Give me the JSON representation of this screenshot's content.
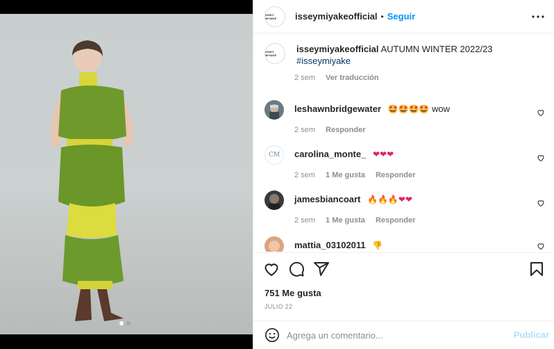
{
  "header": {
    "brand_logo_text": "ISSEY MIYAKE",
    "username": "isseymiyakeofficial",
    "separator": "•",
    "follow_label": "Seguir",
    "more_label": "•••"
  },
  "caption": {
    "username": "isseymiyakeofficial",
    "text": "AUTUMN WINTER 2022/23",
    "hashtag": "#isseymiyake",
    "time": "2 sem",
    "translate_label": "Ver traducción"
  },
  "comments": [
    {
      "user": "leshawnbridgewater",
      "emoji": "🤩🤩🤩🤩",
      "text": "wow",
      "time": "2 sem",
      "likes": "",
      "reply_label": "Responder"
    },
    {
      "user": "carolina_monte_",
      "emoji": "❤❤❤",
      "text": "",
      "time": "2 sem",
      "likes": "1 Me gusta",
      "reply_label": "Responder",
      "avatar_text": "CM"
    },
    {
      "user": "jamesbiancoart",
      "emoji": "🔥🔥🔥❤❤",
      "text": "",
      "time": "2 sem",
      "likes": "1 Me gusta",
      "reply_label": "Responder"
    },
    {
      "user": "mattia_03102011",
      "emoji": "👎",
      "text": "",
      "time": "",
      "likes": "",
      "reply_label": ""
    }
  ],
  "actions": {
    "likes_count": "751 Me gusta",
    "date": "JULIO 22",
    "icons": [
      "heart-icon",
      "comment-icon",
      "share-icon",
      "bookmark-icon"
    ]
  },
  "composer": {
    "emoji_icon": "smiley-icon",
    "placeholder": "Agrega un comentario...",
    "publish_label": "Publicar"
  },
  "colors": {
    "link_blue": "#0095f6",
    "hashtag_blue": "#00376b",
    "publish_disabled": "#b2dffc",
    "muted": "#8e8e8e"
  }
}
